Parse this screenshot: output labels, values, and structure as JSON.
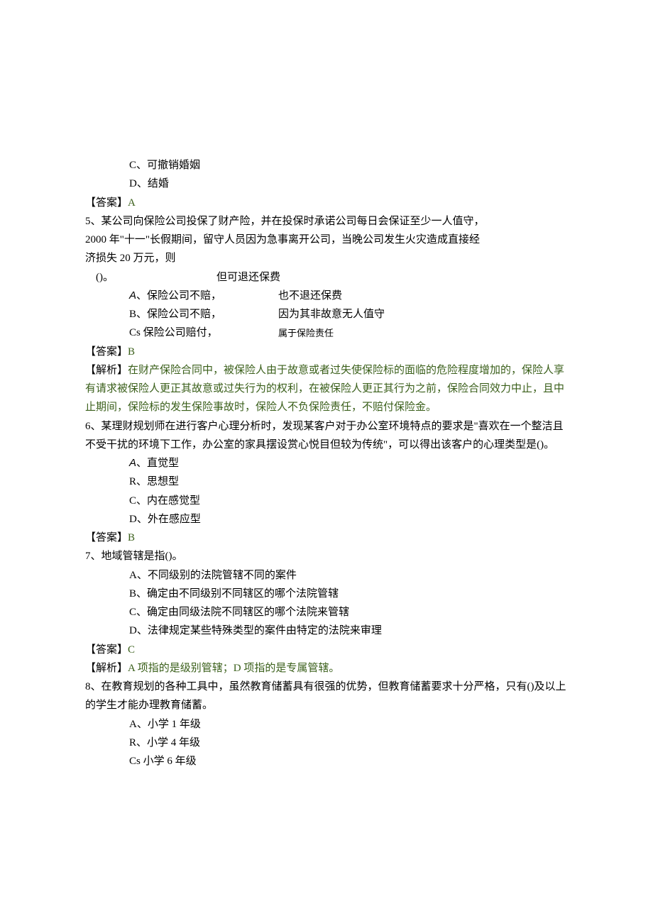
{
  "q4_options_tail": {
    "c": "C、可撤销婚姻",
    "d": "D、结婚"
  },
  "q4_answer_label": "【答案】",
  "q4_answer_letter": "A",
  "q5": {
    "stem_line1": "5、某公司向保险公司投保了财产险，并在投保时承诺公司每日会保证至少一人值守，",
    "stem_line2": "2000 年\"十一\"长假期间，留守人员因为急事离开公司，当晚公司发生火灾造成直接经",
    "stem_line3": "济损失 20 万元，则",
    "stem_line4_left": "()。",
    "stem_line4_right": "但可退还保费",
    "opt_a_left": "A",
    "opt_a_left2": "、保险公司不赔，",
    "opt_a_right": "也不退还保费",
    "opt_b_left": "B、保险公司不赔，",
    "opt_b_right": "因为其非故意无人值守",
    "opt_c_left": "Cs 保险公司赔付，",
    "opt_c_right": "属于保险责任",
    "answer_label": "【答案】",
    "answer_letter": "B",
    "analysis_label": "【解析】",
    "analysis_text": "在财产保险合同中，被保险人由于故意或者过失使保险标的面临的危险程度增加的，保险人享有请求被保险人更正其故意或过失行为的权利，在被保险人更正其行为之前，保险合同效力中止，且中止期间，保险标的发生保险事故时，保险人不负保险责任，不赔付保险金。"
  },
  "q6": {
    "stem": "6、某理财规划师在进行客户心理分析时，发现某客户对于办公室环境特点的要求是\"喜欢在一个整洁且不受干扰的环境下工作，办公室的家具摆设赏心悦目但较为传统\"，可以得出该客户的心理类型是()。",
    "opt_a": "、直觉型",
    "opt_a_prefix": "A",
    "opt_b": "R、思想型",
    "opt_c": "C、内在感觉型",
    "opt_d": "D、外在感应型",
    "answer_label": "【答案】",
    "answer_letter": "B"
  },
  "q7": {
    "stem": "7、地域管辖是指()。",
    "opt_a": "A、不同级别的法院管辖不同的案件",
    "opt_b": "B、确定由不同级别不同辖区的哪个法院管辖",
    "opt_c": "C、确定由同级法院不同辖区的哪个法院来管辖",
    "opt_d": "D、法律规定某些特殊类型的案件由特定的法院来审理",
    "answer_label": "【答案】",
    "answer_letter": "C",
    "analysis_label": "【解析】",
    "analysis_text": "A 项指的是级别管辖；D 项指的是专属管辖。"
  },
  "q8": {
    "stem": "8、在教育规划的各种工具中，虽然教育储蓄具有很强的优势，但教育储蓄要求十分严格，只有()及以上的学生才能办理教育储蓄。",
    "opt_a": "A、小学 1 年级",
    "opt_b": "R、小学 4 年级",
    "opt_c": "Cs 小学 6 年级"
  }
}
